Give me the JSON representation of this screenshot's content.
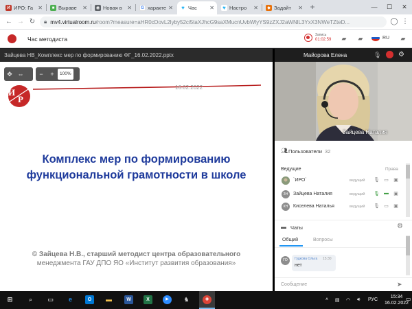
{
  "browser": {
    "tabs": [
      {
        "title": "ИРО: Га",
        "color": "#c0392b",
        "glyph": "И"
      },
      {
        "title": "Выраве",
        "color": "#4caf50",
        "glyph": "■"
      },
      {
        "title": "Новая в",
        "color": "#5f6368",
        "glyph": "◉"
      },
      {
        "title": "характе",
        "color": "#4285f4",
        "glyph": "G"
      },
      {
        "title": "Час",
        "color": "#29b6f6",
        "glyph": "♥"
      },
      {
        "title": "Настро",
        "color": "#29b6f6",
        "glyph": "♥"
      },
      {
        "title": "Задайт",
        "color": "#e8710a",
        "glyph": "◆"
      }
    ],
    "active_tab_index": 4,
    "url_host": "mv4.virtualroom.ru",
    "url_rest": "/room?measure=aHR0cDovL2lyby52ci5taXJhcG9saXMucnUvbWlyYS9zZXJ2aWNlL3YxX3NWeTZteD...",
    "window_controls": [
      "—",
      "☐",
      "✕"
    ]
  },
  "app": {
    "title": "Час методиста",
    "record_label": "Запись",
    "record_time": "01:02:59",
    "language": "RU"
  },
  "presentation": {
    "file_name": "Зайцева НВ_Комплекс мер по формированию ФГ_16.02.2022.pptx",
    "zoom": "100%",
    "zoom_minus": "−",
    "zoom_plus": "+",
    "slide": {
      "date": "16.02.2022",
      "title_line1": "Комплекс мер по формированию",
      "title_line2": "функциональной грамотности в школе",
      "author_line1": "© Зайцева Н.В., старший методист центра образовательного",
      "author_line2": "менеджмента ГАУ ДПО ЯО «Институт развития образования»"
    }
  },
  "video": {
    "top_name": "Майорова Елена",
    "speaker_name": "Зайцева Наталия"
  },
  "participants": {
    "label": "Пользователи",
    "count": "32",
    "section": "Ведущие",
    "rights_label": "Права",
    "rows": [
      {
        "initials": "",
        "name": "`ИРО`",
        "role": "ведущий",
        "avatar_color": "#9e9e9e"
      },
      {
        "initials": "ЗН",
        "name": "Зайцева Наталия",
        "role": "ведущий",
        "avatar_color": "#9e9e9e"
      },
      {
        "initials": "КН",
        "name": "Киселева Наталья",
        "role": "ведущий",
        "avatar_color": "#9e9e9e"
      }
    ]
  },
  "chat": {
    "label": "Чаты",
    "tabs": [
      "Общий",
      "Вопросы"
    ],
    "active_tab": 0,
    "messages": [
      {
        "initials": "ГО",
        "from": "Гудкова Ольга",
        "time": "15:30",
        "text": "нет"
      }
    ],
    "input_placeholder": "Сообщение"
  },
  "taskbar": {
    "language": "РУС",
    "time": "15:34",
    "date": "16.02.2022"
  },
  "colors": {
    "slide_title": "#1f3b9c",
    "record_red": "#d32f2f",
    "mic_active": "#43a047"
  }
}
